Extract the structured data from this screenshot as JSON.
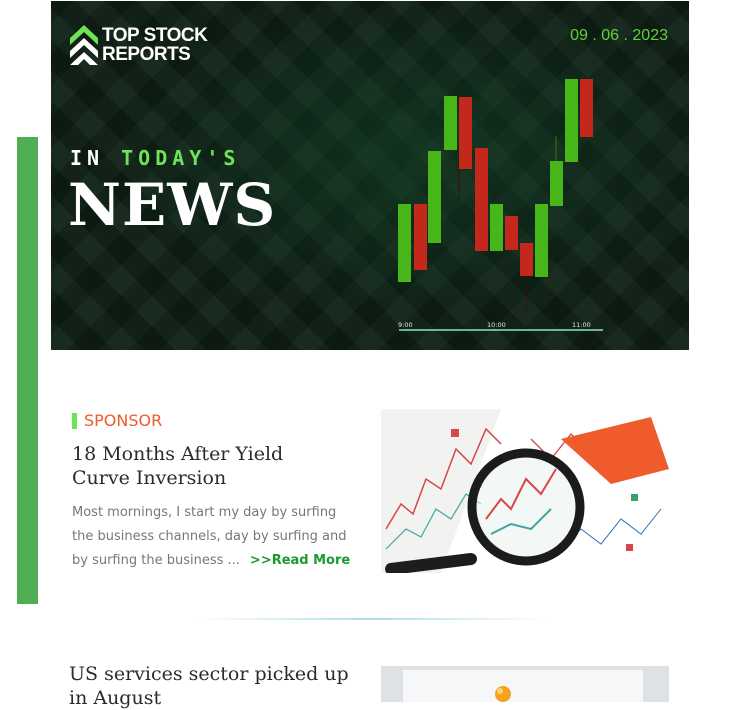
{
  "header": {
    "logo_line1": "TOP STOCK",
    "logo_line2": "REPORTS",
    "date": "09 . 06 . 2023",
    "tagline_prefix": "IN",
    "tagline_highlight": "TODAY'S",
    "headline": "NEWS",
    "chart_times": [
      "9:00",
      "10:00",
      "11:00"
    ]
  },
  "articles": [
    {
      "label": "SPONSOR",
      "title": "18 Months After Yield Curve Inversion",
      "excerpt": "Most mornings, I start my day by surfing the business channels,  day by surfing and by surfing the business ...",
      "read_more": ">>Read More",
      "image": "magnifying-glass-over-financial-chart"
    },
    {
      "title": "US services sector picked up in August",
      "image": "pushpin-on-document"
    }
  ],
  "colors": {
    "accent_green": "#4fad53",
    "candle_up": "#46b619",
    "candle_down": "#c4281c",
    "sponsor_orange": "#ef5b2a",
    "link_green": "#1a9a2f"
  }
}
